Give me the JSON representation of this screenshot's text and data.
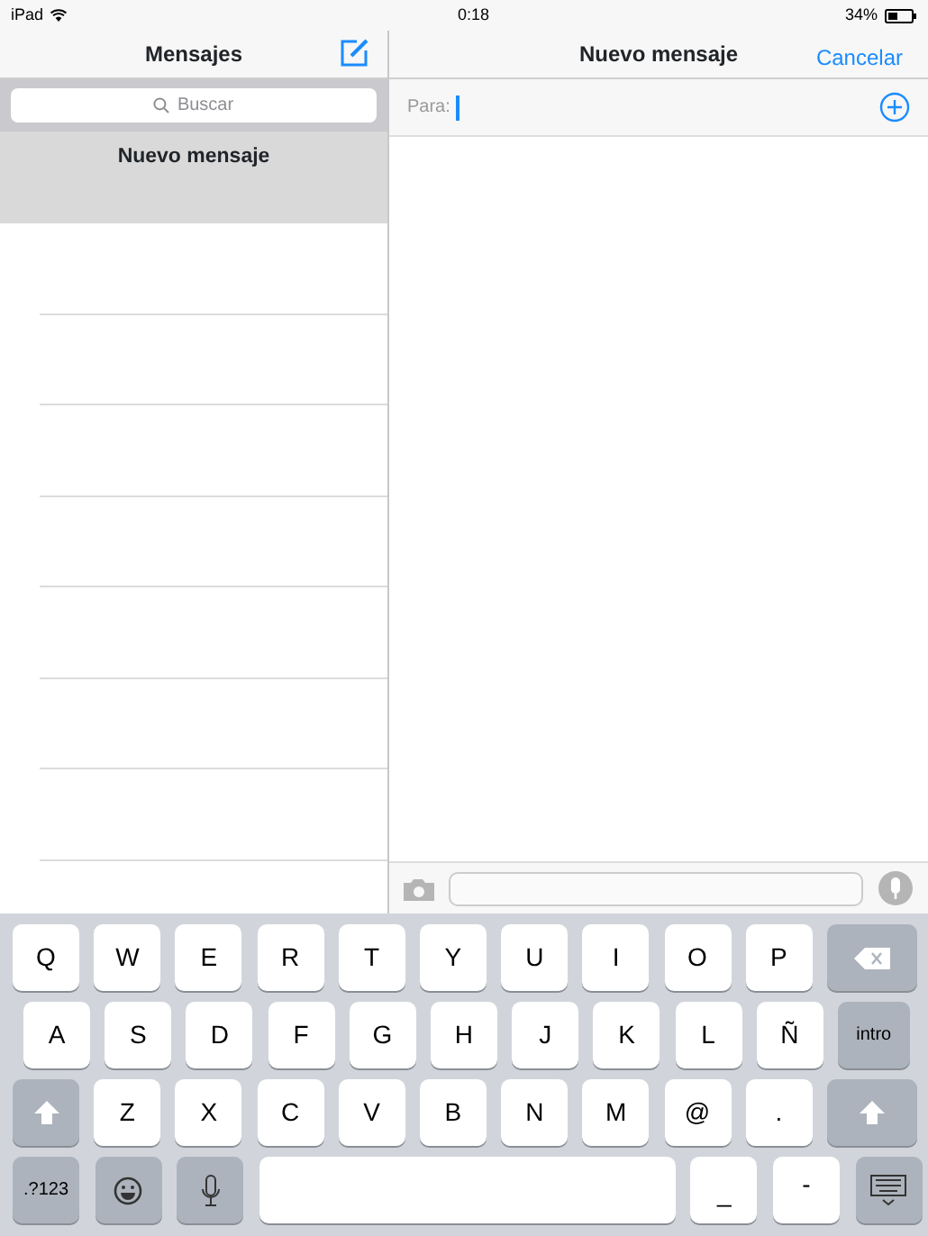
{
  "status_bar": {
    "carrier": "iPad",
    "time": "0:18",
    "battery": "34%"
  },
  "sidebar": {
    "title": "Mensajes",
    "search": {
      "placeholder": "Buscar"
    },
    "conversations": [
      {
        "title": "Nuevo mensaje",
        "selected": true
      }
    ]
  },
  "compose": {
    "title": "Nuevo mensaje",
    "cancel": "Cancelar",
    "to_label": "Para:"
  },
  "keyboard": {
    "rows": [
      [
        {
          "kind": "letter",
          "label": "Q"
        },
        {
          "kind": "letter",
          "label": "W"
        },
        {
          "kind": "letter",
          "label": "E"
        },
        {
          "kind": "letter",
          "label": "R"
        },
        {
          "kind": "letter",
          "label": "T"
        },
        {
          "kind": "letter",
          "label": "Y"
        },
        {
          "kind": "letter",
          "label": "U"
        },
        {
          "kind": "letter",
          "label": "I"
        },
        {
          "kind": "letter",
          "label": "O"
        },
        {
          "kind": "letter",
          "label": "P"
        },
        {
          "kind": "backspace"
        }
      ],
      [
        {
          "kind": "letter",
          "label": "A"
        },
        {
          "kind": "letter",
          "label": "S"
        },
        {
          "kind": "letter",
          "label": "D"
        },
        {
          "kind": "letter",
          "label": "F"
        },
        {
          "kind": "letter",
          "label": "G"
        },
        {
          "kind": "letter",
          "label": "H"
        },
        {
          "kind": "letter",
          "label": "J"
        },
        {
          "kind": "letter",
          "label": "K"
        },
        {
          "kind": "letter",
          "label": "L"
        },
        {
          "kind": "letter",
          "label": "Ñ"
        },
        {
          "kind": "function",
          "label": "intro"
        }
      ],
      [
        {
          "kind": "shift"
        },
        {
          "kind": "letter",
          "label": "Z"
        },
        {
          "kind": "letter",
          "label": "X"
        },
        {
          "kind": "letter",
          "label": "C"
        },
        {
          "kind": "letter",
          "label": "V"
        },
        {
          "kind": "letter",
          "label": "B"
        },
        {
          "kind": "letter",
          "label": "N"
        },
        {
          "kind": "letter",
          "label": "M"
        },
        {
          "kind": "letter",
          "label": "@"
        },
        {
          "kind": "letter",
          "label": "."
        },
        {
          "kind": "shift"
        }
      ],
      [
        {
          "kind": "function",
          "label": ".?123"
        },
        {
          "kind": "emoji"
        },
        {
          "kind": "dictation"
        },
        {
          "kind": "space"
        },
        {
          "kind": "letter",
          "label": "_"
        },
        {
          "kind": "letter",
          "label": "-"
        },
        {
          "kind": "hide"
        }
      ]
    ]
  }
}
